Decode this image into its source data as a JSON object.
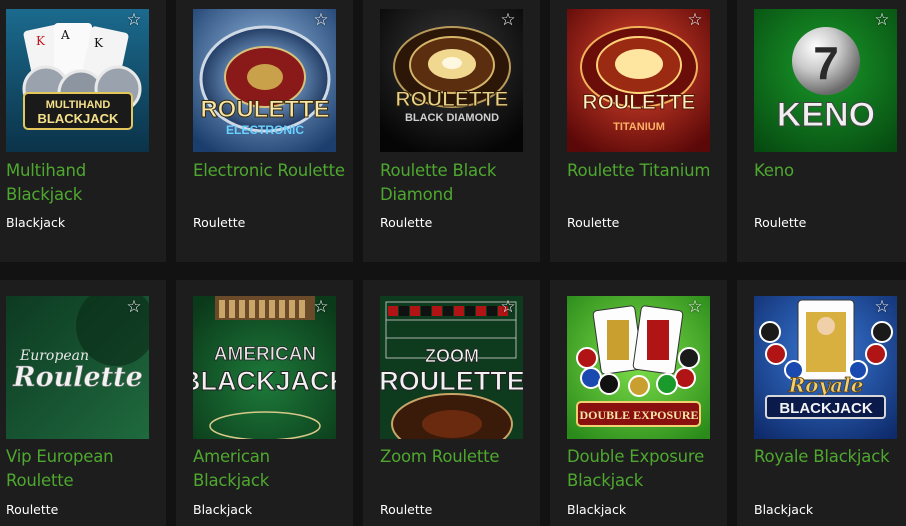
{
  "games": [
    {
      "title": "Multihand Blackjack",
      "category": "Blackjack",
      "art_text": [
        "MULTIHAND",
        "BLACKJACK"
      ],
      "favorite_icon": "star-outline-icon"
    },
    {
      "title": "Electronic Roulette",
      "category": "Roulette",
      "art_text": [
        "ROULETTE",
        "ELECTRONIC"
      ],
      "favorite_icon": "star-outline-icon"
    },
    {
      "title": "Roulette Black Diamond",
      "category": "Roulette",
      "art_text": [
        "ROULETTE",
        "BLACK DIAMOND"
      ],
      "favorite_icon": "star-outline-icon"
    },
    {
      "title": "Roulette Titanium",
      "category": "Roulette",
      "art_text": [
        "ROULETTE",
        "TITANIUM"
      ],
      "favorite_icon": "star-outline-icon"
    },
    {
      "title": "Keno",
      "category": "Roulette",
      "art_text": [
        "7",
        "KENO"
      ],
      "favorite_icon": "star-outline-icon"
    },
    {
      "title": "Vip European Roulette",
      "category": "Roulette",
      "art_text": [
        "European",
        "Roulette"
      ],
      "favorite_icon": "star-outline-icon"
    },
    {
      "title": "American Blackjack",
      "category": "Blackjack",
      "art_text": [
        "AMERICAN",
        "BLACKJACK"
      ],
      "favorite_icon": "star-outline-icon"
    },
    {
      "title": "Zoom Roulette",
      "category": "Roulette",
      "art_text": [
        "ZOOM",
        "ROULETTE"
      ],
      "favorite_icon": "star-outline-icon"
    },
    {
      "title": "Double Exposure Blackjack",
      "category": "Blackjack",
      "art_text": [
        "DOUBLE EXPOSURE"
      ],
      "favorite_icon": "star-outline-icon"
    },
    {
      "title": "Royale Blackjack",
      "category": "Blackjack",
      "art_text": [
        "Royale",
        "BLACKJACK"
      ],
      "favorite_icon": "star-outline-icon"
    }
  ],
  "colors": {
    "page_background": "#121212",
    "card_background": "#1d1d1d",
    "title": "#4ea82f",
    "category": "#ffffff"
  }
}
